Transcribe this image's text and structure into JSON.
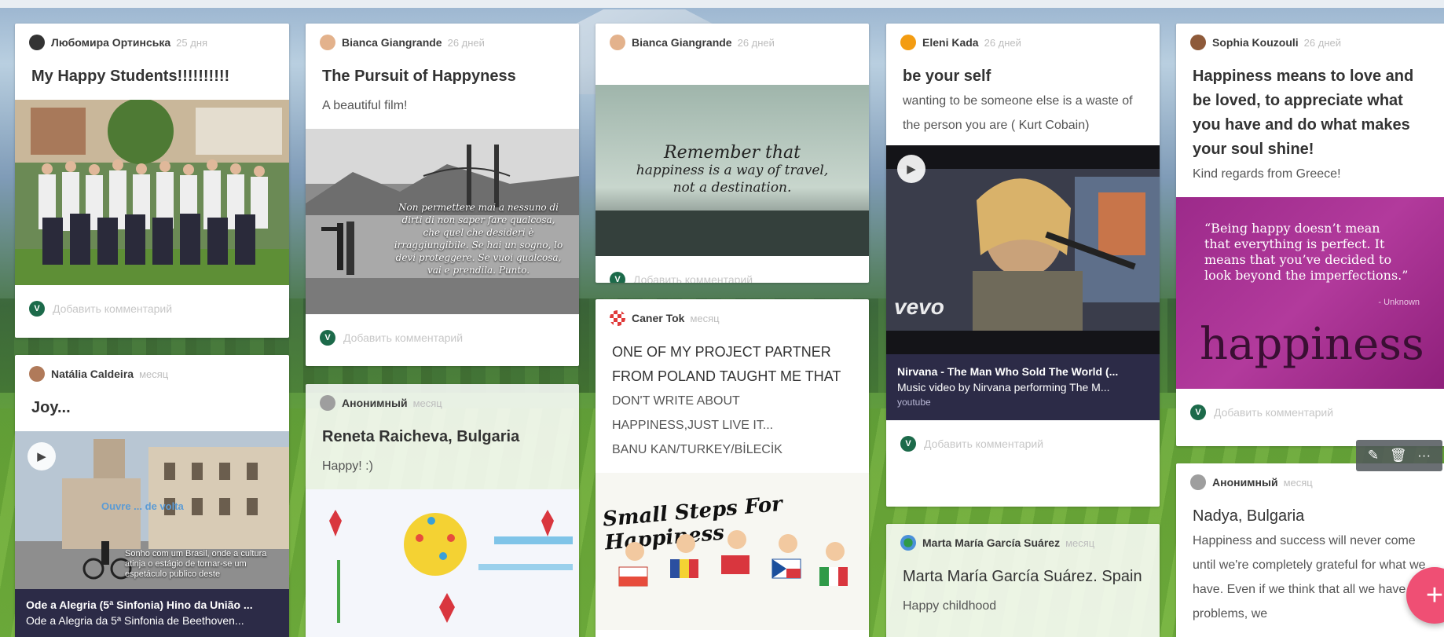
{
  "comment_placeholder": "Добавить комментарий",
  "posts": [
    {
      "author": "Любомира Ортинська",
      "time": "25 дня",
      "title": "My Happy Students!!!!!!!!!!"
    },
    {
      "author": "Bianca Giangrande",
      "time": "26 дней",
      "title": "The Pursuit of Happyness",
      "body": "A beautiful film!",
      "image_quote": "Non permettere mai a nessuno di dirti di non saper fare qualcosa, che quel che desideri è irraggiungibile. Se hai un sogno, lo devi proteggere. Se vuoi qualcosa, vai e prendila. Punto."
    },
    {
      "author": "Bianca Giangrande",
      "time": "26 дней",
      "image_quote_1": "Remember that",
      "image_quote_2": "happiness is a way of travel,",
      "image_quote_3": "not a destination."
    },
    {
      "author": "Eleni Kada",
      "time": "26 дней",
      "title": "be your self",
      "body": "wanting to be someone else is a waste of the person you are ( Kurt Cobain)",
      "video_title": "Nirvana - The Man Who Sold The World (...",
      "video_desc": "Music video by Nirvana performing The M...",
      "video_source": "youtube",
      "video_logo": "vevo"
    },
    {
      "author": "Sophia Kouzouli",
      "time": "26 дней",
      "title": "Happiness means to love and be loved, to appreciate what you have and do what makes your soul shine!",
      "body": "Kind regards from Greece!",
      "image_quote": "“Being happy doesn’t mean that everything is perfect. It means that you’ve decided to look beyond the imperfections.”",
      "image_attrib": "- Unknown",
      "image_word": "happiness"
    },
    {
      "author": "Natália Caldeira",
      "time": "месяц",
      "title": "Joy...",
      "image_overlay": "Ouvre ... de volta",
      "image_caption": "Sonho com um Brasil, onde a cultura atinja o estágio de tornar-se um espetáculo publico deste",
      "video_title": "Ode a Alegria (5ª Sinfonia) Hino da União ...",
      "video_desc": "Ode a Alegria da 5ª Sinfonia de Beethoven..."
    },
    {
      "author": "Анонимный",
      "time": "месяц",
      "title": "Reneta Raicheva, Bulgaria",
      "body": "Happy! :)"
    },
    {
      "author": "Caner Tok",
      "time": "месяц",
      "title": "ONE OF MY PROJECT PARTNER FROM POLAND TAUGHT ME THAT",
      "body_lines": [
        "DON'T WRITE ABOUT",
        "HAPPINESS,JUST LIVE IT...",
        "BANU KAN/TURKEY/BİLECİK"
      ],
      "image_text": "Small Steps For Happiness"
    },
    {
      "author": "Marta María García Suárez",
      "time": "месяц",
      "title": "Marta María García Suárez. Spain",
      "body": "Happy childhood"
    },
    {
      "author": "Анонимный",
      "time": "месяц",
      "title": "Nadya, Bulgaria",
      "body": "Happiness and success will never come until we're completely grateful for what we have. Even if we think that all we have are problems, we"
    }
  ],
  "toolbar": {
    "edit": "✎",
    "delete": "🗑",
    "more": "···"
  },
  "fab_label": "+"
}
